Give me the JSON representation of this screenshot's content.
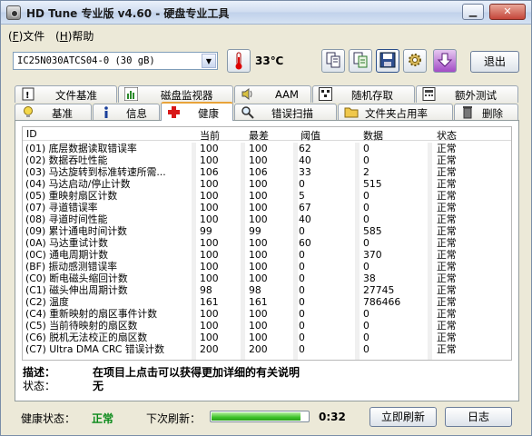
{
  "window": {
    "title": "HD Tune 专业版 v4.60 - 硬盘专业工具"
  },
  "menu": {
    "file": "文件",
    "file_key": "F",
    "help": "帮助",
    "help_key": "H"
  },
  "toolbar": {
    "drive": "IC25N030ATCS04-0 (30 gB)",
    "temperature": "33℃",
    "exit": "退出"
  },
  "tabs_row1": [
    "文件基准",
    "磁盘监视器",
    "AAM",
    "随机存取",
    "额外测试"
  ],
  "tabs_row2": [
    "基准",
    "信息",
    "健康",
    "错误扫描",
    "文件夹占用率",
    "删除"
  ],
  "active_tab": "健康",
  "smart": {
    "headers": {
      "id": "ID",
      "current": "当前",
      "worst": "最差",
      "threshold": "阈值",
      "data": "数据",
      "status": "状态"
    },
    "rows": [
      {
        "id": "(01) 底层数据读取错误率",
        "current": "100",
        "worst": "100",
        "threshold": "62",
        "data": "0",
        "status": "正常"
      },
      {
        "id": "(02) 数据吞吐性能",
        "current": "100",
        "worst": "100",
        "threshold": "40",
        "data": "0",
        "status": "正常"
      },
      {
        "id": "(03) 马达旋转到标准转速所需...",
        "current": "106",
        "worst": "106",
        "threshold": "33",
        "data": "2",
        "status": "正常"
      },
      {
        "id": "(04) 马达启动/停止计数",
        "current": "100",
        "worst": "100",
        "threshold": "0",
        "data": "515",
        "status": "正常"
      },
      {
        "id": "(05) 重映射扇区计数",
        "current": "100",
        "worst": "100",
        "threshold": "5",
        "data": "0",
        "status": "正常"
      },
      {
        "id": "(07) 寻道错误率",
        "current": "100",
        "worst": "100",
        "threshold": "67",
        "data": "0",
        "status": "正常"
      },
      {
        "id": "(08) 寻道时间性能",
        "current": "100",
        "worst": "100",
        "threshold": "40",
        "data": "0",
        "status": "正常"
      },
      {
        "id": "(09) 累计通电时间计数",
        "current": "99",
        "worst": "99",
        "threshold": "0",
        "data": "585",
        "status": "正常"
      },
      {
        "id": "(0A) 马达重试计数",
        "current": "100",
        "worst": "100",
        "threshold": "60",
        "data": "0",
        "status": "正常"
      },
      {
        "id": "(0C) 通电周期计数",
        "current": "100",
        "worst": "100",
        "threshold": "0",
        "data": "370",
        "status": "正常"
      },
      {
        "id": "(BF) 振动感测错误率",
        "current": "100",
        "worst": "100",
        "threshold": "0",
        "data": "0",
        "status": "正常"
      },
      {
        "id": "(C0) 断电磁头缩回计数",
        "current": "100",
        "worst": "100",
        "threshold": "0",
        "data": "38",
        "status": "正常"
      },
      {
        "id": "(C1) 磁头伸出周期计数",
        "current": "98",
        "worst": "98",
        "threshold": "0",
        "data": "27745",
        "status": "正常"
      },
      {
        "id": "(C2) 温度",
        "current": "161",
        "worst": "161",
        "threshold": "0",
        "data": "786466",
        "status": "正常"
      },
      {
        "id": "(C4) 重新映射的扇区事件计数",
        "current": "100",
        "worst": "100",
        "threshold": "0",
        "data": "0",
        "status": "正常"
      },
      {
        "id": "(C5) 当前待映射的扇区数",
        "current": "100",
        "worst": "100",
        "threshold": "0",
        "data": "0",
        "status": "正常"
      },
      {
        "id": "(C6) 脱机无法校正的扇区数",
        "current": "100",
        "worst": "100",
        "threshold": "0",
        "data": "0",
        "status": "正常"
      },
      {
        "id": "(C7) Ultra DMA CRC 错误计数",
        "current": "200",
        "worst": "200",
        "threshold": "0",
        "data": "0",
        "status": "正常"
      }
    ]
  },
  "details": {
    "desc_label": "描述：",
    "desc_text": "在项目上点击可以获得更加详细的有关说明",
    "status_label": "状态：",
    "status_text": "无"
  },
  "footer": {
    "health_label": "健康状态：",
    "health_value": "正常",
    "next_refresh_label": "下次刷新：",
    "refresh_progress": 0.92,
    "countdown": "0:32",
    "refresh_now": "立即刷新",
    "log": "日志"
  },
  "colors": {
    "health_ok": "#0a8a1a",
    "active_tab_accent": "#e8a33a"
  }
}
